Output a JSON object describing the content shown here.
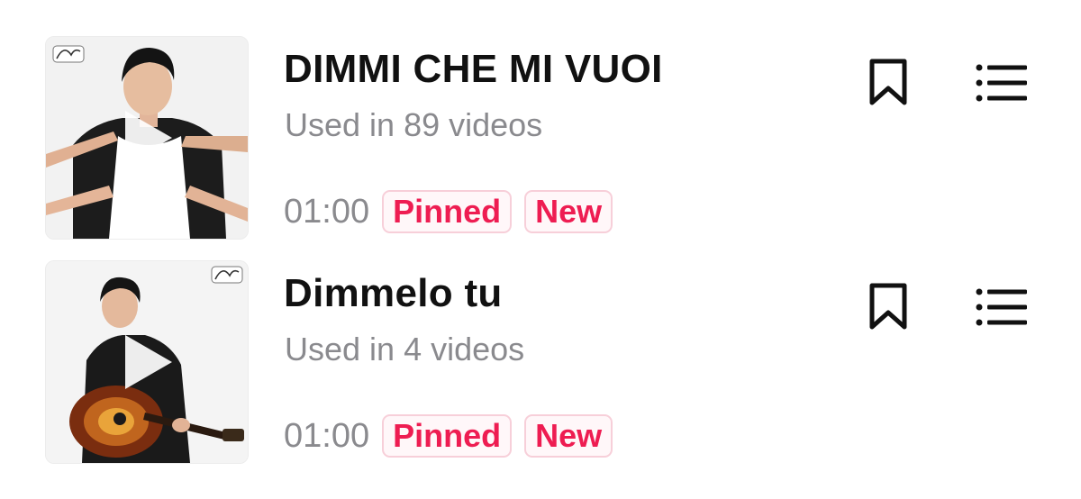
{
  "tracks": [
    {
      "title": "DIMMI CHE MI VUOI",
      "usage": "Used in 89 videos",
      "duration": "01:00",
      "badges": [
        "Pinned",
        "New"
      ],
      "cover_icon": "play-icon",
      "save_icon": "bookmark-icon",
      "menu_icon": "list-icon"
    },
    {
      "title": "Dimmelo tu",
      "usage": "Used in 4 videos",
      "duration": "01:00",
      "badges": [
        "Pinned",
        "New"
      ],
      "cover_icon": "play-icon",
      "save_icon": "bookmark-icon",
      "menu_icon": "list-icon"
    }
  ],
  "colors": {
    "title": "#111111",
    "secondary_text": "#8a8a8e",
    "badge_text": "#ee1d52",
    "badge_border": "#f7cfd9"
  }
}
